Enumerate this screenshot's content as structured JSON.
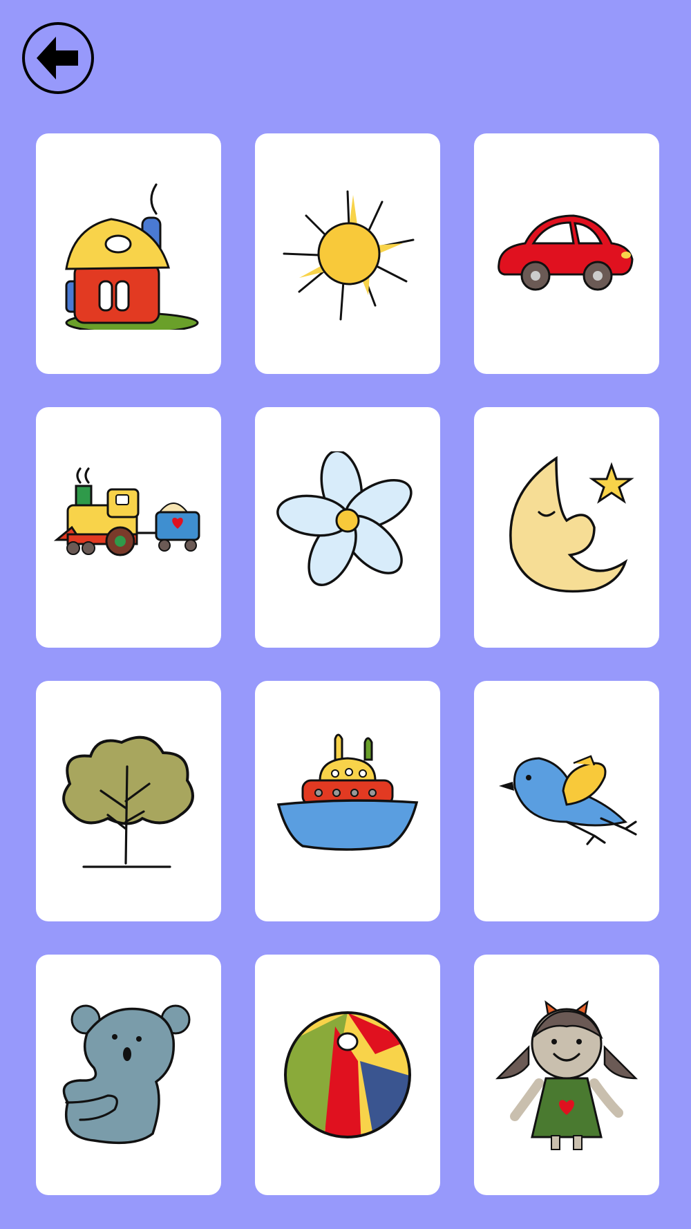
{
  "header": {
    "back_icon": "arrow-left-icon"
  },
  "colors": {
    "background": "#9799fb",
    "card": "#ffffff"
  },
  "cards": [
    {
      "icon": "house-icon"
    },
    {
      "icon": "sun-icon"
    },
    {
      "icon": "car-icon"
    },
    {
      "icon": "train-icon"
    },
    {
      "icon": "flower-icon"
    },
    {
      "icon": "moon-star-icon"
    },
    {
      "icon": "tree-icon"
    },
    {
      "icon": "boat-icon"
    },
    {
      "icon": "bird-icon"
    },
    {
      "icon": "teddy-bear-icon"
    },
    {
      "icon": "beach-ball-icon"
    },
    {
      "icon": "doll-icon"
    }
  ]
}
